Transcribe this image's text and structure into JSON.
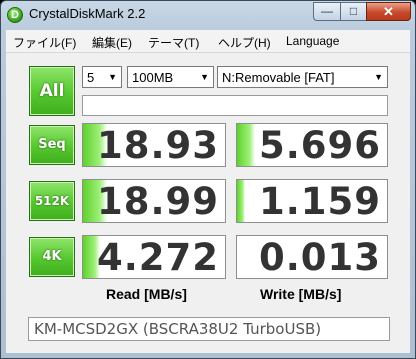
{
  "window": {
    "title": "CrystalDiskMark 2.2",
    "app_icon_glyph": "D",
    "minimize_glyph": "—",
    "maximize_glyph": "□",
    "close_glyph": "✕"
  },
  "menu": [
    "ファイル(F)",
    "編集(E)",
    "テーマ(T)",
    "ヘルプ(H)",
    "Language"
  ],
  "controls": {
    "all_label": "All",
    "passes": "5",
    "size": "100MB",
    "drive": "N:Removable [FAT]"
  },
  "rows": [
    {
      "label": "Seq",
      "read": "18.93",
      "write": "5.696",
      "read_level": 0.17,
      "write_level": 0.12
    },
    {
      "label": "512K",
      "read": "18.99",
      "write": "1.159",
      "read_level": 0.17,
      "write_level": 0.05
    },
    {
      "label": "4K",
      "read": "4.272",
      "write": "0.013",
      "read_level": 0.12,
      "write_level": 0.0
    }
  ],
  "columns": {
    "read_label": "Read [MB/s]",
    "write_label": "Write [MB/s]"
  },
  "comment": "KM-MCSD2GX (BSCRA38U2 TurboUSB)",
  "colors": {
    "bar_green": "#5fd12d",
    "button_green": "#55c72f",
    "close_red": "#c74a2c"
  }
}
